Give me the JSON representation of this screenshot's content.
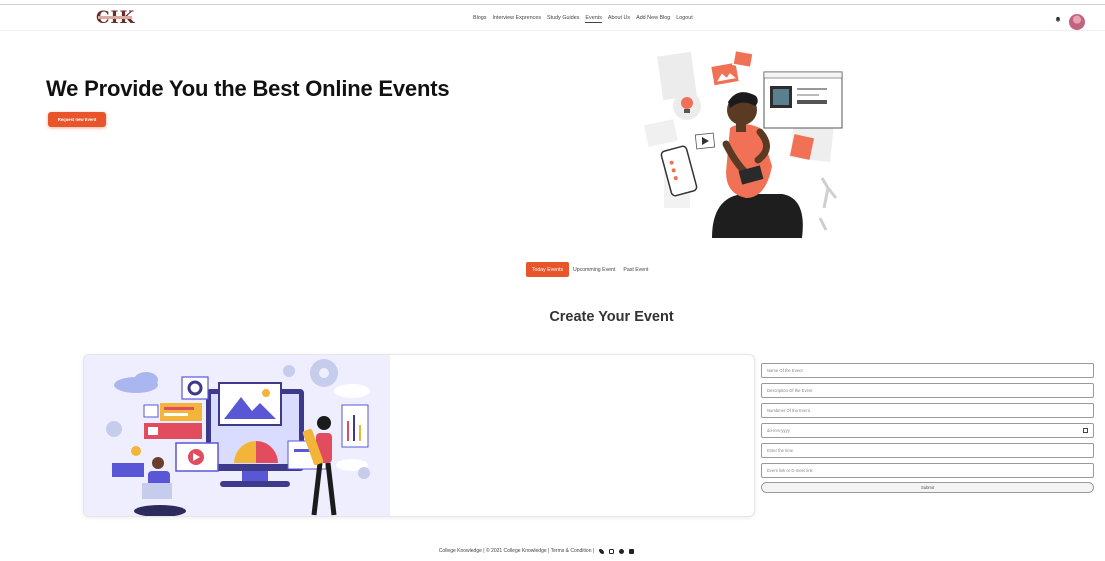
{
  "header": {
    "logo_text": "CIK",
    "nav": [
      "Blogs",
      "Interview Exprences",
      "Study Guides",
      "Events",
      "About Us",
      "Add New Blog",
      "Logout"
    ],
    "active_nav": "Events"
  },
  "hero": {
    "title": "We Provide You the Best Online Events",
    "request_button": "Request new Event"
  },
  "tabs": [
    "Today Events",
    "Upcomming Event",
    "Past Event"
  ],
  "create": {
    "title": "Create Your Event"
  },
  "form": {
    "name_placeholder": "Name Of the Event",
    "description_placeholder": "Description Of the Event",
    "number_placeholder": "Numbmer Of the Event",
    "date_placeholder": "dd-mm-yyyy",
    "time_placeholder": "Enter the time",
    "link_placeholder": "Event link or G-meet link",
    "submit_label": "Submit"
  },
  "footer": {
    "text": "College Knowledge | © 2021 College Knowledge | Terms & Condition |"
  },
  "colors": {
    "accent": "#e8552a",
    "card_bg": "#eeeeff"
  }
}
